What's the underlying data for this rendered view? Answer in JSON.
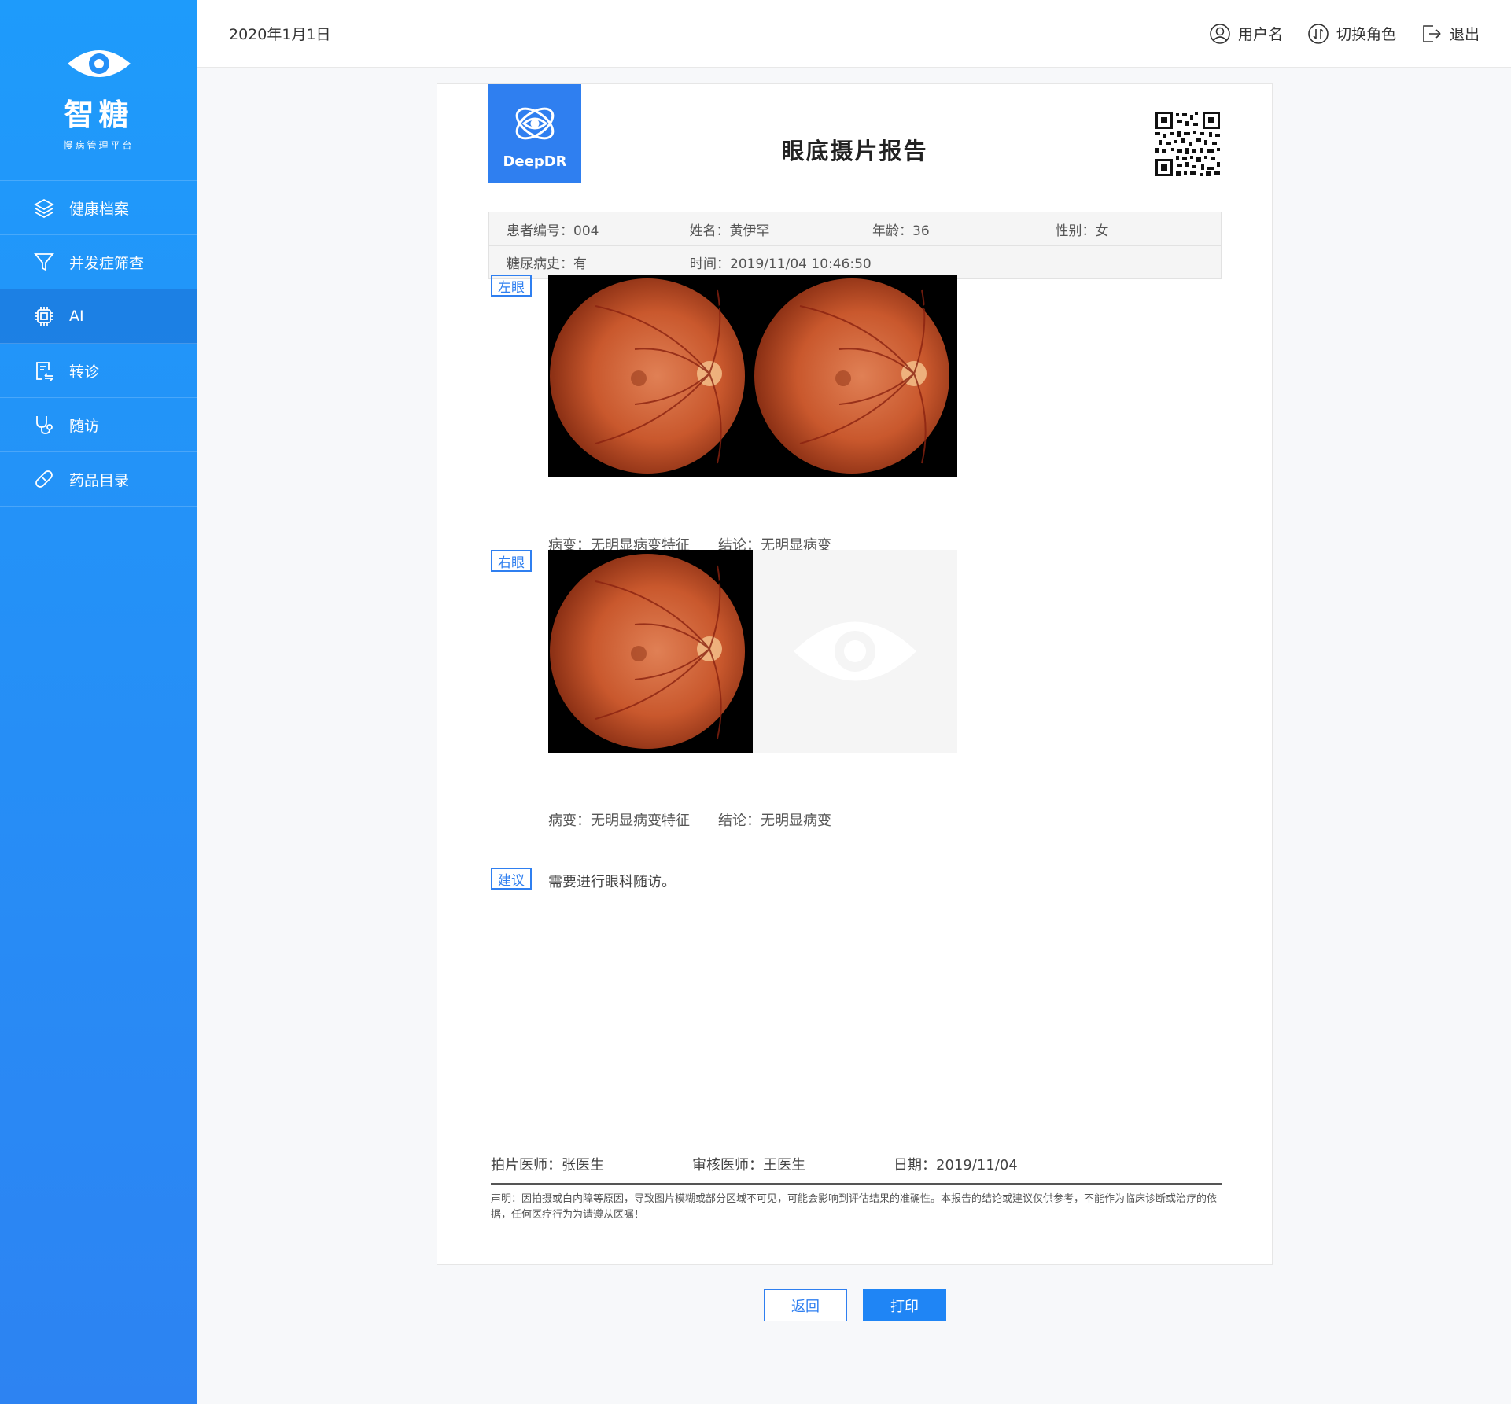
{
  "brand": {
    "name": "智糖",
    "subtitle": "慢病管理平台"
  },
  "sidebar": {
    "items": [
      {
        "label": "健康档案",
        "icon": "layers-icon",
        "active": false
      },
      {
        "label": "并发症筛查",
        "icon": "filter-icon",
        "active": false
      },
      {
        "label": "AI",
        "icon": "chip-icon",
        "active": true
      },
      {
        "label": "转诊",
        "icon": "referral-icon",
        "active": false
      },
      {
        "label": "随访",
        "icon": "stethoscope-icon",
        "active": false
      },
      {
        "label": "药品目录",
        "icon": "pill-icon",
        "active": false
      }
    ]
  },
  "header": {
    "date": "2020年1月1日",
    "user_label": "用户名",
    "switch_role_label": "切换角色",
    "logout_label": "退出"
  },
  "report": {
    "logo_text": "DeepDR",
    "title": "眼底摄片报告",
    "patient": {
      "id": "患者编号：004",
      "name": "姓名：黄伊罕",
      "age": "年龄：36",
      "gender": "性别：女",
      "history": "糖尿病史：有",
      "time": "时间：2019/11/04  10:46:50"
    },
    "left_eye": {
      "tag": "左眼",
      "lesion": "病变：无明显病变特征",
      "conclusion": "结论：无明显病变"
    },
    "right_eye": {
      "tag": "右眼",
      "lesion": "病变：无明显病变特征",
      "conclusion": "结论：无明显病变"
    },
    "advice": {
      "tag": "建议",
      "text": "需要进行眼科随访。"
    },
    "signatures": {
      "photographer": "拍片医师：张医生",
      "reviewer": "审核医师：王医生",
      "date": "日期：2019/11/04"
    },
    "disclaimer": "声明：因拍摄或白内障等原因，导致图片模糊或部分区域不可见，可能会影响到评估结果的准确性。本报告的结论或建议仅供参考，不能作为临床诊断或治疗的依据，任何医疗行为为请遵从医嘱！"
  },
  "buttons": {
    "back": "返回",
    "print": "打印"
  },
  "colors": {
    "primary": "#2f7ff0",
    "sidebar_top": "#1e9bfb",
    "sidebar_bottom": "#2d83f2"
  }
}
